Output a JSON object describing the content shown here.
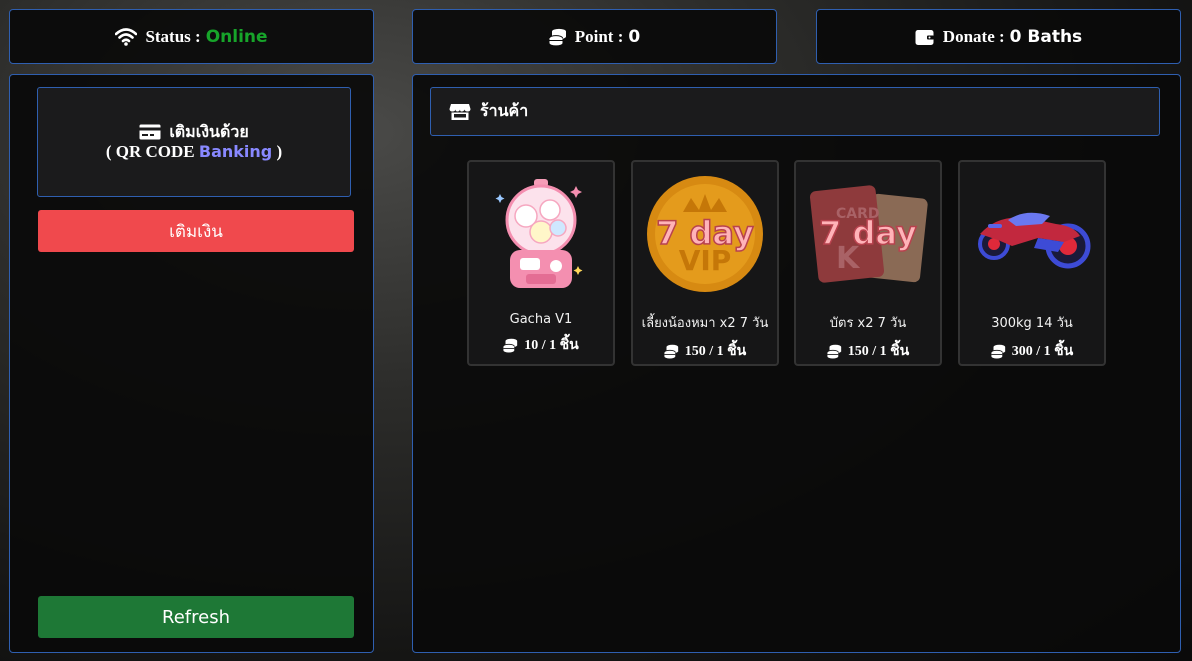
{
  "stats": {
    "status_label": "Status :",
    "status_value": "Online",
    "status_color": "#17a52a",
    "point_label": "Point :",
    "point_value": "0",
    "donate_label": "Donate :",
    "donate_value": "0 Baths"
  },
  "topup": {
    "title": "เติมเงินด้วย",
    "subtitle_prefix": "( QR CODE",
    "subtitle_highlight": "Banking",
    "subtitle_suffix": ")",
    "button_label": "เติมเงิน",
    "refresh_label": "Refresh"
  },
  "shop": {
    "title": "ร้านค้า",
    "items": [
      {
        "name": "Gacha V1",
        "price": "10 / 1 ชิ้น",
        "image": "gacha-machine"
      },
      {
        "name": "เลี้ยงน้องหมา x2 7 วัน",
        "price": "150 / 1 ชิ้น",
        "image": "vip-coin",
        "badge": "7 day"
      },
      {
        "name": "บัตร x2 7 วัน",
        "price": "150 / 1 ชิ้น",
        "image": "cards",
        "badge": "7 day"
      },
      {
        "name": "300kg 14 วัน",
        "price": "300 / 1 ชิ้น",
        "image": "motorbike"
      }
    ]
  },
  "icons": {
    "status": "wifi-icon",
    "point": "coins-icon",
    "donate": "wallet-icon",
    "topup": "credit-card-icon",
    "shop": "store-icon",
    "price": "coins-icon"
  },
  "colors": {
    "border": "#2f5fb0",
    "topup_button": "#f0494d",
    "refresh_button": "#1e7836",
    "banking": "#8888ff"
  }
}
